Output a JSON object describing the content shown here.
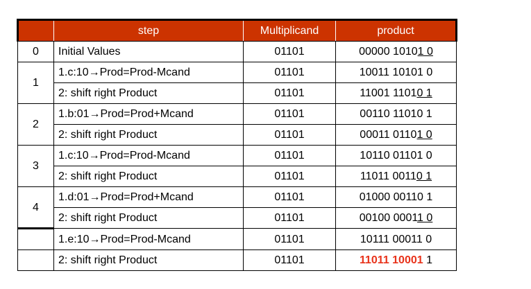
{
  "headers": {
    "iteration": "",
    "step": "step",
    "multiplicand": "Multiplicand",
    "product": "product"
  },
  "rows": {
    "r0": {
      "iteration": "0",
      "step": "Initial Values",
      "multiplicand": "01101",
      "prod_a": "00000 1010",
      "prod_u": "1 0",
      "prod_b": ""
    },
    "r1": {
      "iteration": "1",
      "step": "1.c:10→Prod=Prod-Mcand",
      "multiplicand": "01101",
      "prod_a": "10011 10101 0",
      "prod_u": "",
      "prod_b": ""
    },
    "r2": {
      "step": "2: shift right Product",
      "multiplicand": "01101",
      "prod_a": "11001 1101",
      "prod_u": "0 1",
      "prod_b": ""
    },
    "r3": {
      "iteration": "2",
      "step": "1.b:01→Prod=Prod+Mcand",
      "multiplicand": "01101",
      "prod_a": "00110 11010 1",
      "prod_u": "",
      "prod_b": ""
    },
    "r4": {
      "step": "2: shift right Product",
      "multiplicand": "01101",
      "prod_a": "00011 0110",
      "prod_u": "1 0",
      "prod_b": ""
    },
    "r5": {
      "iteration": "3",
      "step": "1.c:10→Prod=Prod-Mcand",
      "multiplicand": "01101",
      "prod_a": "10110 01101 0",
      "prod_u": "",
      "prod_b": ""
    },
    "r6": {
      "step": "2: shift right Product",
      "multiplicand": "01101",
      "prod_a": "11011 0011",
      "prod_u": "0 1",
      "prod_b": ""
    },
    "r7": {
      "iteration": "4",
      "step": "1.d:01→Prod=Prod+Mcand",
      "multiplicand": "01101",
      "prod_a": "01000 00110 1",
      "prod_u": "",
      "prod_b": ""
    },
    "r8": {
      "step": "2: shift right Product",
      "multiplicand": "01101",
      "prod_a": "00100 0001",
      "prod_u": "1 0",
      "prod_b": ""
    },
    "r9": {
      "iteration": "",
      "step": "1.e:10→Prod=Prod-Mcand",
      "multiplicand": "01101",
      "prod_a": "10111 00011 0",
      "prod_u": "",
      "prod_b": ""
    },
    "r10": {
      "iteration": "",
      "step": "2: shift right Product",
      "multiplicand": "01101",
      "prod_hl": "11011 10001",
      "prod_b": " 1"
    }
  },
  "colors": {
    "header_bg": "#cc3300",
    "header_text": "#ffffff",
    "highlight": "#e8321a",
    "extra_border": "#c8732a"
  }
}
